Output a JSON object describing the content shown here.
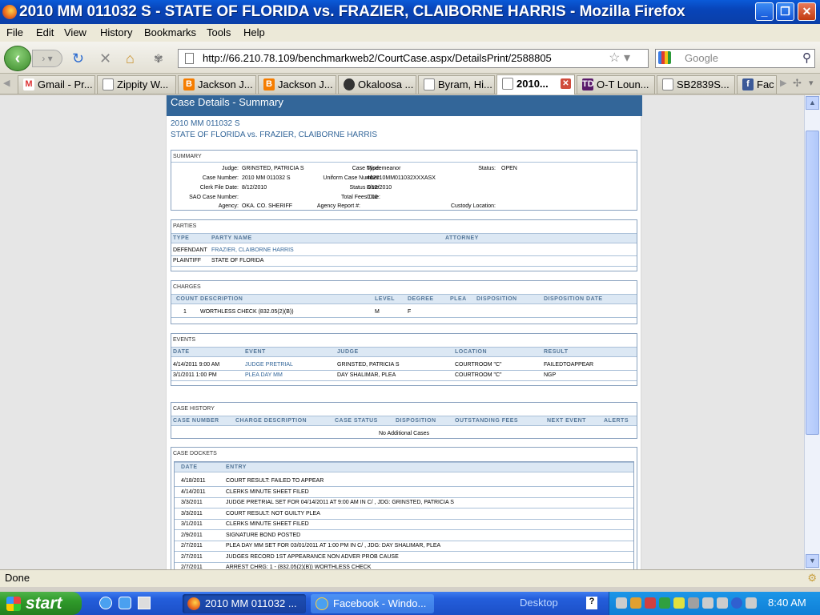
{
  "window": {
    "title": "2010 MM 011032 S - STATE OF FLORIDA vs. FRAZIER, CLAIBORNE HARRIS - Mozilla Firefox"
  },
  "menu": [
    "File",
    "Edit",
    "View",
    "History",
    "Bookmarks",
    "Tools",
    "Help"
  ],
  "nav": {
    "url": "http://66.210.78.109/benchmarkweb2/CourtCase.aspx/DetailsPrint/2588805",
    "search_placeholder": "Google"
  },
  "tabs": [
    {
      "label": "Gmail - Pr...",
      "icon": "gmail-icon"
    },
    {
      "label": "Zippity W...",
      "icon": "page-icon"
    },
    {
      "label": "Jackson J...",
      "icon": "blogger-icon"
    },
    {
      "label": "Jackson J...",
      "icon": "blogger-icon"
    },
    {
      "label": "Okaloosa ...",
      "icon": "clock-icon"
    },
    {
      "label": "Byram, Hi...",
      "icon": "page-icon"
    },
    {
      "label": "2010...",
      "icon": "page-icon",
      "active": true
    },
    {
      "label": "O-T Loun...",
      "icon": "td-icon"
    },
    {
      "label": "SB2839S...",
      "icon": "page-icon"
    },
    {
      "label": "Fac",
      "icon": "facebook-icon"
    }
  ],
  "page": {
    "header": "Case Details - Summary",
    "case_number": "2010 MM 011032 S",
    "case_title": "STATE OF FLORIDA vs. FRAZIER, CLAIBORNE HARRIS",
    "summary": {
      "title": "SUMMARY",
      "judge_label": "Judge:",
      "judge": "GRINSTED, PATRICIA S",
      "case_type_label": "Case Type:",
      "case_type": "Misdemeanor",
      "status_label": "Status:",
      "status": "OPEN",
      "case_number_label": "Case Number:",
      "case_number": "2010 MM 011032 S",
      "ucn_label": "Uniform Case Number:",
      "ucn": "462010MM011032XXXASX",
      "clerk_file_date_label": "Clerk File Date:",
      "clerk_file_date": "8/12/2010",
      "status_date_label": "Status Date:",
      "status_date": "8/12/2010",
      "sao_label": "SAO Case Number:",
      "total_fees_label": "Total Fees Due:",
      "total_fees": "0.00",
      "agency_label": "Agency:",
      "agency": "OKA. CO. SHERIFF",
      "agency_report_label": "Agency Report #:",
      "custody_label": "Custody Location:"
    },
    "parties": {
      "title": "PARTIES",
      "headers": [
        "TYPE",
        "PARTY NAME",
        "ATTORNEY"
      ],
      "rows": [
        [
          "DEFENDANT",
          "FRAZIER, CLAIBORNE HARRIS",
          ""
        ],
        [
          "PLAINTIFF",
          "STATE OF FLORIDA",
          ""
        ]
      ]
    },
    "charges": {
      "title": "CHARGES",
      "headers": [
        "COUNT",
        "DESCRIPTION",
        "LEVEL",
        "DEGREE",
        "PLEA",
        "DISPOSITION",
        "DISPOSITION DATE"
      ],
      "rows": [
        [
          "1",
          "WORTHLESS CHECK (832.05(2)(B))",
          "M",
          "F",
          "",
          "",
          ""
        ]
      ]
    },
    "events": {
      "title": "EVENTS",
      "headers": [
        "DATE",
        "EVENT",
        "JUDGE",
        "LOCATION",
        "RESULT"
      ],
      "rows": [
        [
          "4/14/2011 9:00 AM",
          "JUDGE PRETRIAL",
          "GRINSTED, PATRICIA S",
          "COURTROOM \"C\"",
          "FAILEDTOAPPEAR"
        ],
        [
          "3/1/2011 1:00 PM",
          "PLEA DAY MM",
          "DAY SHALIMAR, PLEA",
          "COURTROOM \"C\"",
          "NGP"
        ]
      ]
    },
    "case_history": {
      "title": "CASE HISTORY",
      "headers": [
        "CASE NUMBER",
        "CHARGE DESCRIPTION",
        "CASE STATUS",
        "DISPOSITION",
        "OUTSTANDING FEES",
        "NEXT EVENT",
        "ALERTS"
      ],
      "empty": "No Additional Cases"
    },
    "dockets": {
      "title": "CASE DOCKETS",
      "headers": [
        "DATE",
        "ENTRY"
      ],
      "rows": [
        [
          "4/18/2011",
          "COURT RESULT: FAILED TO APPEAR"
        ],
        [
          "4/14/2011",
          "CLERKS MINUTE SHEET FILED"
        ],
        [
          "3/3/2011",
          "JUDGE PRETRIAL SET FOR 04/14/2011 AT 9:00 AM IN C/ , JDG: GRINSTED, PATRICIA S"
        ],
        [
          "3/3/2011",
          "COURT RESULT: NOT GUILTY PLEA"
        ],
        [
          "3/1/2011",
          "CLERKS MINUTE SHEET FILED"
        ],
        [
          "2/9/2011",
          "SIGNATURE BOND POSTED"
        ],
        [
          "2/7/2011",
          "PLEA DAY MM SET FOR 03/01/2011 AT 1:00 PM IN C/ , JDG: DAY SHALIMAR, PLEA"
        ],
        [
          "2/7/2011",
          "JUDGES RECORD 1ST APPEARANCE NON ADVER PROB CAUSE"
        ],
        [
          "2/7/2011",
          "ARREST CHRG: 1 - (832.05(2)(B)) WORTHLESS CHECK"
        ]
      ]
    }
  },
  "status_text": "Done",
  "taskbar": {
    "start": "start",
    "buttons": [
      {
        "label": "2010 MM 011032 ...",
        "icon": "firefox-icon"
      },
      {
        "label": "Facebook - Windo...",
        "icon": "ie-icon"
      }
    ],
    "desktop_label": "Desktop",
    "clock": "8:40 AM"
  }
}
